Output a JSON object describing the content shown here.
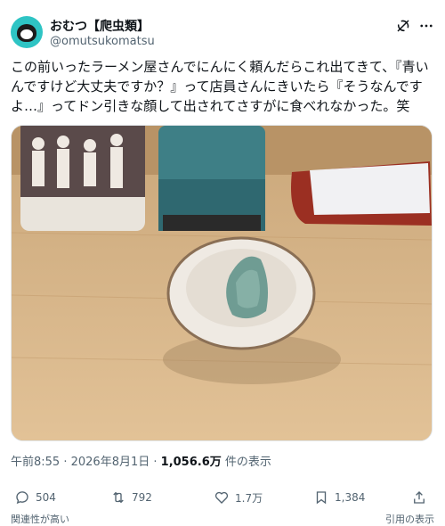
{
  "user": {
    "display_name": "おむつ【爬虫類】",
    "handle": "@omutsukomatsu"
  },
  "tweet": {
    "text": "この前いったラーメン屋さんでにんにく頼んだらこれ出てきて、『青いんですけど大丈夫ですか？』って店員さんにきいたら『そうなんですよ…』ってドン引きな顔して出されてさすがに食べれなかった。笑"
  },
  "meta": {
    "time": "午前8:55",
    "separator1": " · ",
    "date": "2026年8月1日",
    "separator2": " · ",
    "views_count": "1,056.6万",
    "views_label": " 件の表示"
  },
  "actions": {
    "replies": "504",
    "reposts": "792",
    "likes": "1.7万",
    "bookmarks": "1,384"
  },
  "footer": {
    "left_text": "関連性が高い",
    "right_text": "引用の表示"
  },
  "icons": [
    "avatar-icon",
    "grok-icon",
    "more-icon",
    "reply-icon",
    "repost-icon",
    "like-icon",
    "bookmark-icon",
    "share-icon"
  ],
  "colors": {
    "secondary_text": "#536471",
    "primary_text": "#0f1419",
    "avatar_bg": "#2ec4c4"
  }
}
